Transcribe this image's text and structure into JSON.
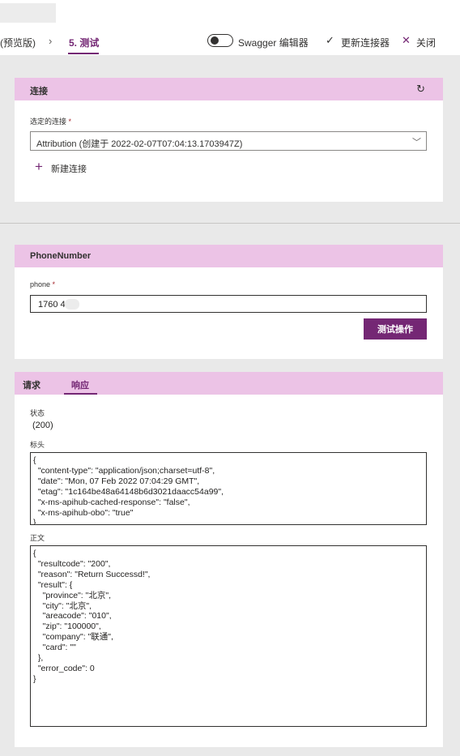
{
  "nav": {
    "prev_crumb": "(预览版)",
    "current_step": "5. 测试",
    "swagger_label": "Swagger 编辑器",
    "update_label": "更新连接器",
    "close_label": "关闭"
  },
  "connection": {
    "header": "连接",
    "selected_label": "选定的连接",
    "required_mark": "*",
    "selected_value": "Attribution (创建于 2022-02-07T07:04:13.1703947Z)",
    "new_connection": "新建连接"
  },
  "phone_section": {
    "header": "PhoneNumber",
    "field_label": "phone",
    "required_mark": "*",
    "value": "1760 490",
    "test_button": "测试操作"
  },
  "response": {
    "tabs": [
      "请求",
      "响应"
    ],
    "active_tab": "响应",
    "status_label": "状态",
    "status_value": "(200)",
    "headers_label": "标头",
    "headers_lines": [
      "{",
      "  \"content-type\": \"application/json;charset=utf-8\",",
      "  \"date\": \"Mon, 07 Feb 2022 07:04:29 GMT\",",
      "  \"etag\": \"1c164be48a64148b6d3021daacc54a99\",",
      "  \"x-ms-apihub-cached-response\": \"false\",",
      "  \"x-ms-apihub-obo\": \"true\"",
      "}"
    ],
    "body_label": "正文",
    "body_lines": [
      "{",
      "  \"resultcode\": \"200\",",
      "  \"reason\": \"Return Successd!\",",
      "  \"result\": {",
      "    \"province\": \"北京\",",
      "    \"city\": \"北京\",",
      "    \"areacode\": \"010\",",
      "    \"zip\": \"100000\",",
      "    \"company\": \"联通\",",
      "    \"card\": \"\"",
      "  },",
      "  \"error_code\": 0",
      "}"
    ]
  },
  "colors": {
    "accent": "#742774",
    "header_bg": "#ecc3e6",
    "page_bg": "#e9e9e9",
    "required": "#a4262c"
  }
}
